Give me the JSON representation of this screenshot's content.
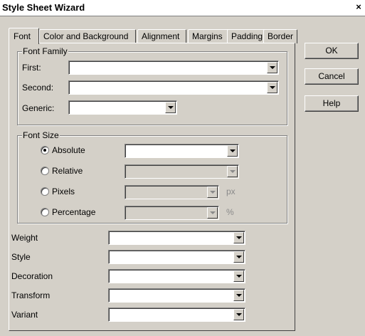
{
  "window": {
    "title": "Style Sheet Wizard",
    "close_glyph": "×"
  },
  "tabs": [
    {
      "label": "Font"
    },
    {
      "label": "Color and Background"
    },
    {
      "label": "Alignment"
    },
    {
      "label": "Margins"
    },
    {
      "label": "Padding"
    },
    {
      "label": "Border"
    }
  ],
  "font_family": {
    "group_label": "Font Family",
    "first_label": "First:",
    "second_label": "Second:",
    "generic_label": "Generic:",
    "first_value": "",
    "second_value": "",
    "generic_value": ""
  },
  "font_size": {
    "group_label": "Font Size",
    "options": [
      {
        "label": "Absolute",
        "checked": true,
        "unit": ""
      },
      {
        "label": "Relative",
        "checked": false,
        "unit": ""
      },
      {
        "label": "Pixels",
        "checked": false,
        "unit": "px"
      },
      {
        "label": "Percentage",
        "checked": false,
        "unit": "%"
      }
    ]
  },
  "properties": [
    {
      "label": "Weight",
      "value": ""
    },
    {
      "label": "Style",
      "value": ""
    },
    {
      "label": "Decoration",
      "value": ""
    },
    {
      "label": "Transform",
      "value": ""
    },
    {
      "label": "Variant",
      "value": ""
    }
  ],
  "buttons": {
    "ok": "OK",
    "cancel": "Cancel",
    "help": "Help"
  },
  "icons": {
    "dropdown": "chevron-down-icon",
    "close": "close-icon"
  }
}
